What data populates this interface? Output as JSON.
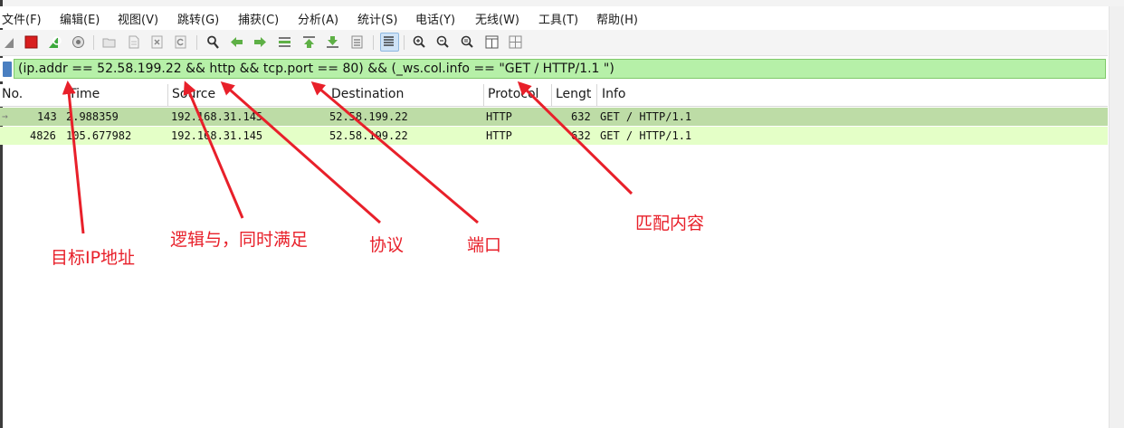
{
  "menu": [
    "文件(F)",
    "编辑(E)",
    "视图(V)",
    "跳转(G)",
    "捕获(C)",
    "分析(A)",
    "统计(S)",
    "电话(Y)",
    "无线(W)",
    "工具(T)",
    "帮助(H)"
  ],
  "toolbar_icons": [
    "shark-fin-icon",
    "stop-capture-icon",
    "restart-capture-icon",
    "capture-options-icon",
    "open-file-icon",
    "save-file-icon",
    "close-file-icon",
    "reload-file-icon",
    "find-packet-icon",
    "go-back-icon",
    "go-forward-icon",
    "go-to-packet-icon",
    "go-first-icon",
    "go-last-icon",
    "auto-scroll-icon",
    "colorize-icon",
    "zoom-in-icon",
    "zoom-out-icon",
    "zoom-normal-icon",
    "resize-columns-icon",
    "layout-icon"
  ],
  "filter": {
    "text": "(ip.addr == 52.58.199.22 && http && tcp.port == 80) && (_ws.col.info == \"GET / HTTP/1.1 \")",
    "bg_color": "#b6f0a8"
  },
  "columns": [
    "No.",
    "Time",
    "Source",
    "Destination",
    "Protocol",
    "Lengt",
    "Info"
  ],
  "packets": [
    {
      "no": "143",
      "time": "2.988359",
      "source": "192.168.31.145",
      "destination": "52.58.199.22",
      "protocol": "HTTP",
      "length": "632",
      "info": "GET / HTTP/1.1"
    },
    {
      "no": "4826",
      "time": "105.677982",
      "source": "192.168.31.145",
      "destination": "52.58.199.22",
      "protocol": "HTTP",
      "length": "632",
      "info": "GET / HTTP/1.1"
    }
  ],
  "annotations": {
    "target_ip": "目标IP地址",
    "logic_and": "逻辑与，同时满足",
    "protocol": "协议",
    "port": "端口",
    "match_content": "匹配内容"
  },
  "colors": {
    "annotation": "#e8202a",
    "selected_row": "#bddca6",
    "http_row": "#e4ffc7"
  }
}
